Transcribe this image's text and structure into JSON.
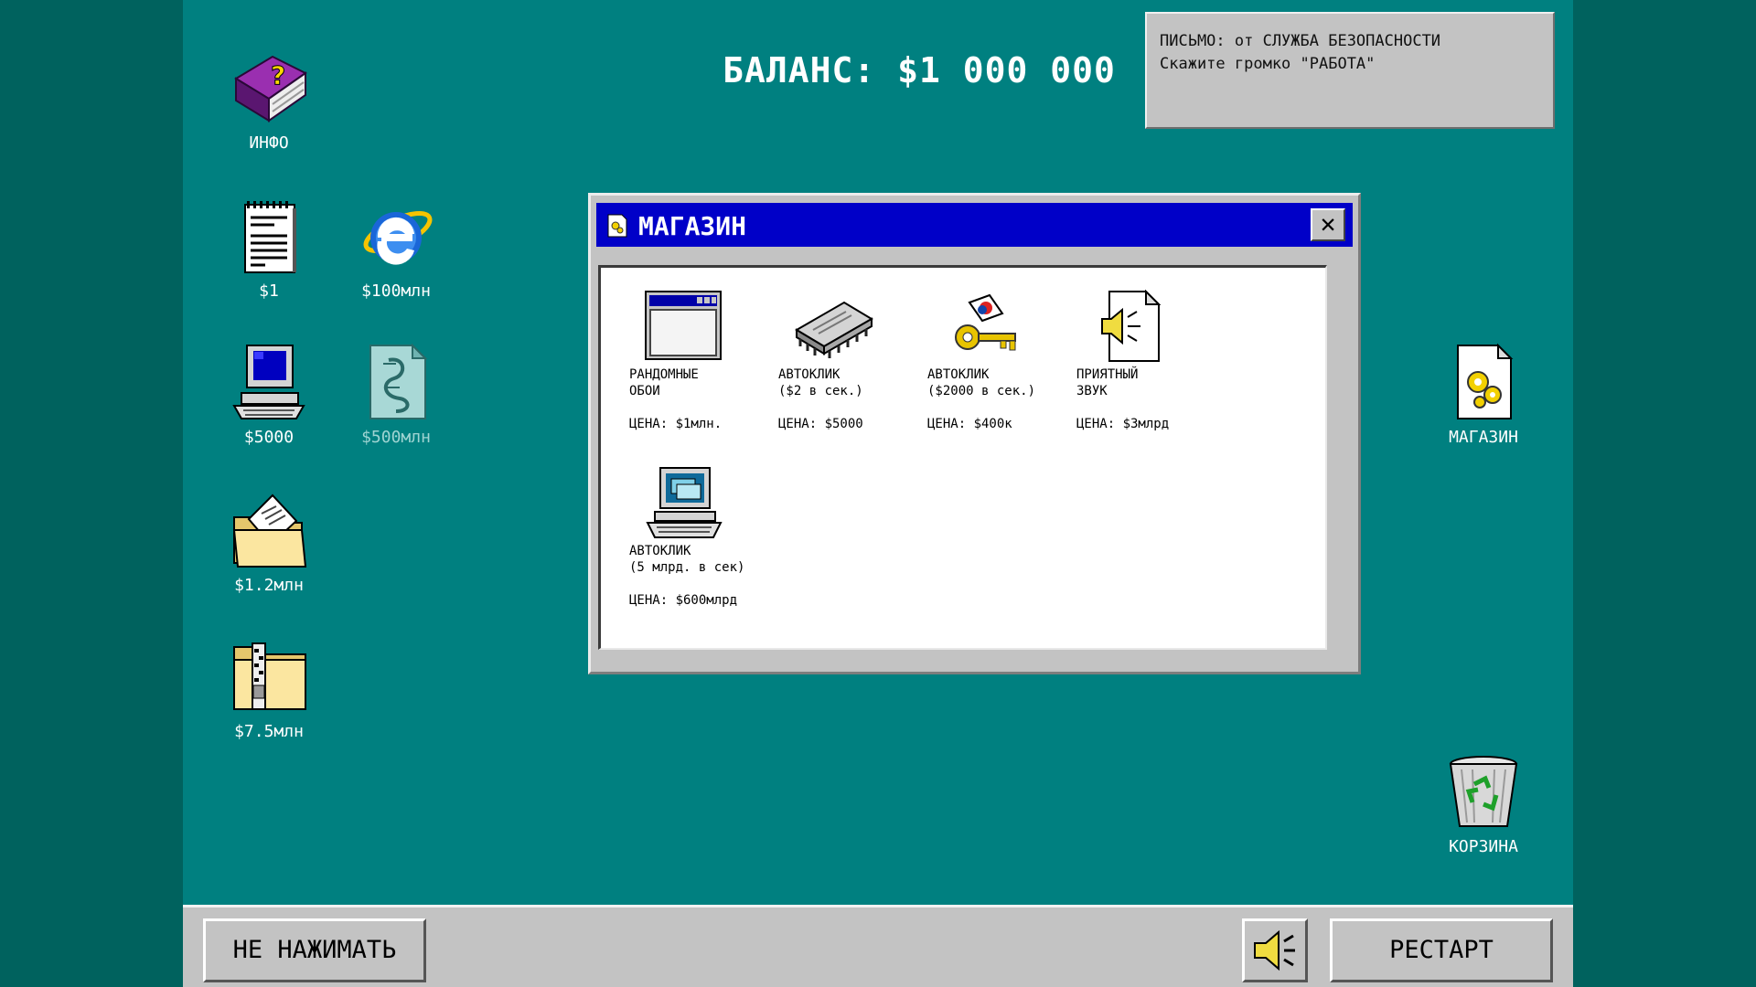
{
  "balance": "БАЛАНС: $1 000 000",
  "mail": {
    "line1": "ПИСЬМО: от СЛУЖБА БЕЗОПАСНОСТИ",
    "line2": "Скажите громко \"РАБОТА\""
  },
  "desktop_icons": {
    "info": "ИНФО",
    "notepad": "$1",
    "ie": "$100млн",
    "computer": "$5000",
    "script": "$500млн",
    "folder_docs": "$1.2млн",
    "folder_zip": "$7.5млн",
    "shop": "МАГАЗИН",
    "trash": "КОРЗИНА"
  },
  "shop_window": {
    "title": "МАГАЗИН",
    "close": "✕",
    "items": [
      {
        "name": "РАНДОМНЫЕ\nОБОИ",
        "price": "ЦЕНА: $1млн.",
        "icon": "window-icon"
      },
      {
        "name": "АВТОКЛИК\n($2 в сек.)",
        "price": "ЦЕНА: $5000",
        "icon": "chip-icon"
      },
      {
        "name": "АВТОКЛИК\n($2000 в сек.)",
        "price": "ЦЕНА: $400к",
        "icon": "key-icon"
      },
      {
        "name": "ПРИЯТНЫЙ\nЗВУК",
        "price": "ЦЕНА: $3млрд",
        "icon": "sound-file-icon"
      },
      {
        "name": "АВТОКЛИК\n(5 млрд. в сек)",
        "price": "ЦЕНА: $600млрд",
        "icon": "computer-icon"
      }
    ]
  },
  "taskbar": {
    "dont_press": "НЕ НАЖИМАТЬ",
    "restart": "РЕСТАРТ"
  }
}
